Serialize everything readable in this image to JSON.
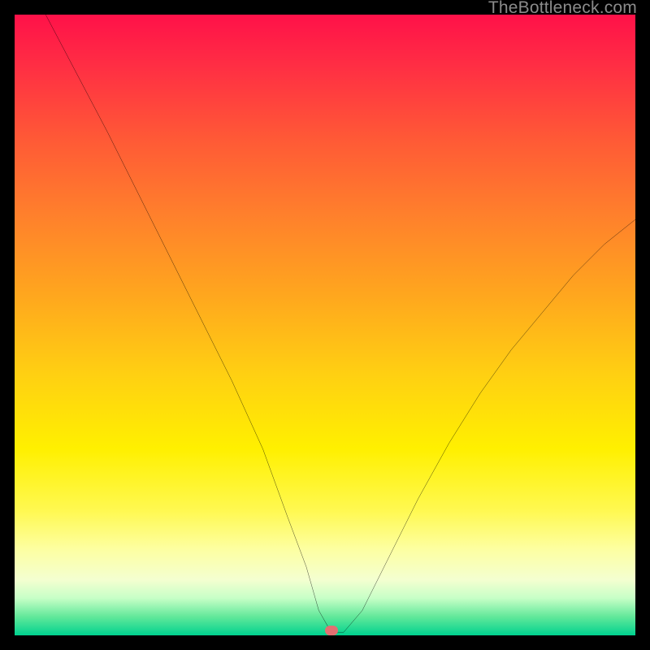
{
  "watermark": "TheBottleneck.com",
  "marker": {
    "x_pct": 51.0,
    "y_pct": 99.2
  },
  "chart_data": {
    "type": "line",
    "title": "",
    "xlabel": "",
    "ylabel": "",
    "xlim": [
      0,
      100
    ],
    "ylim": [
      0,
      100
    ],
    "annotations": [],
    "series": [
      {
        "name": "curve",
        "x": [
          5,
          10,
          15,
          20,
          25,
          30,
          35,
          40,
          44,
          47,
          49,
          51,
          53,
          56,
          60,
          65,
          70,
          75,
          80,
          85,
          90,
          95,
          100
        ],
        "y": [
          100,
          90.5,
          81,
          71,
          61,
          51,
          41,
          30,
          19,
          11,
          4,
          0.5,
          0.5,
          4,
          12,
          22,
          31,
          39,
          46,
          52,
          58,
          63,
          67
        ]
      }
    ]
  }
}
